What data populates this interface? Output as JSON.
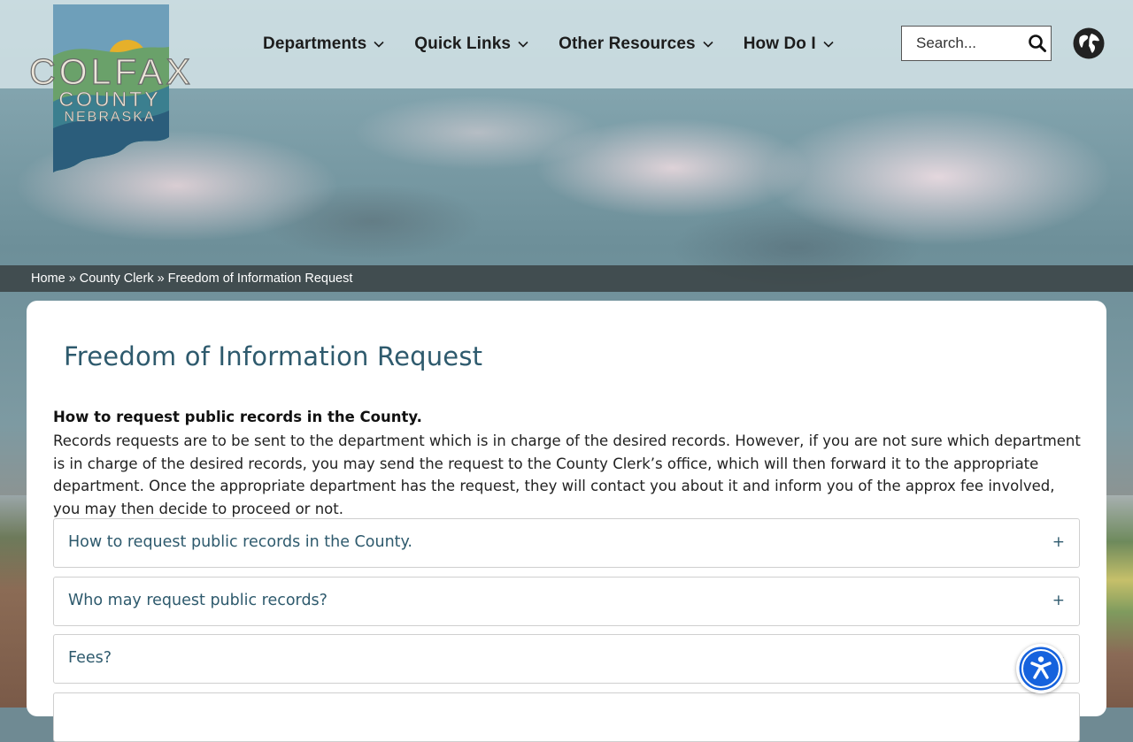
{
  "header": {
    "logo": {
      "line1": "COLFAX",
      "line2": "COUNTY",
      "line3": "NEBRASKA",
      "icon": "colfax-county-logo"
    },
    "nav": [
      {
        "label": "Departments",
        "icon": "chevron-down-icon"
      },
      {
        "label": "Quick Links",
        "icon": "chevron-down-icon"
      },
      {
        "label": "Other Resources",
        "icon": "chevron-down-icon"
      },
      {
        "label": "How Do I",
        "icon": "chevron-down-icon"
      }
    ],
    "search": {
      "placeholder": "Search...",
      "icon": "search-icon"
    },
    "translate_icon": "globe-icon"
  },
  "breadcrumb": {
    "items": [
      "Home",
      "County Clerk"
    ],
    "separator": "»",
    "current": "Freedom of Information Request"
  },
  "main": {
    "title": "Freedom of Information Request",
    "intro_heading": "How to request public records in the County.",
    "intro_body": "Records requests are to be sent to the department which is in charge of the desired records. However, if you are not sure which department is in charge of the desired records, you may send the request to the County Clerk’s office, which will then forward it to the appropriate department. Once the appropriate department has the request, they will contact you about it and inform you of the approx fee involved, you may then decide to proceed or not.",
    "accordion": [
      {
        "title": "How to request public records in the County.",
        "expand_icon": "+"
      },
      {
        "title": "Who may request public records?",
        "expand_icon": "+"
      },
      {
        "title": "Fees?",
        "expand_icon": "+"
      },
      {
        "title": "",
        "expand_icon": ""
      }
    ]
  },
  "accessibility_button": {
    "icon": "accessibility-icon"
  },
  "colors": {
    "accent": "#2e5a6d",
    "header_bg": "#d6e4e8",
    "breadcrumb_bg": "#373e40",
    "a11y_blue": "#1662dd"
  }
}
